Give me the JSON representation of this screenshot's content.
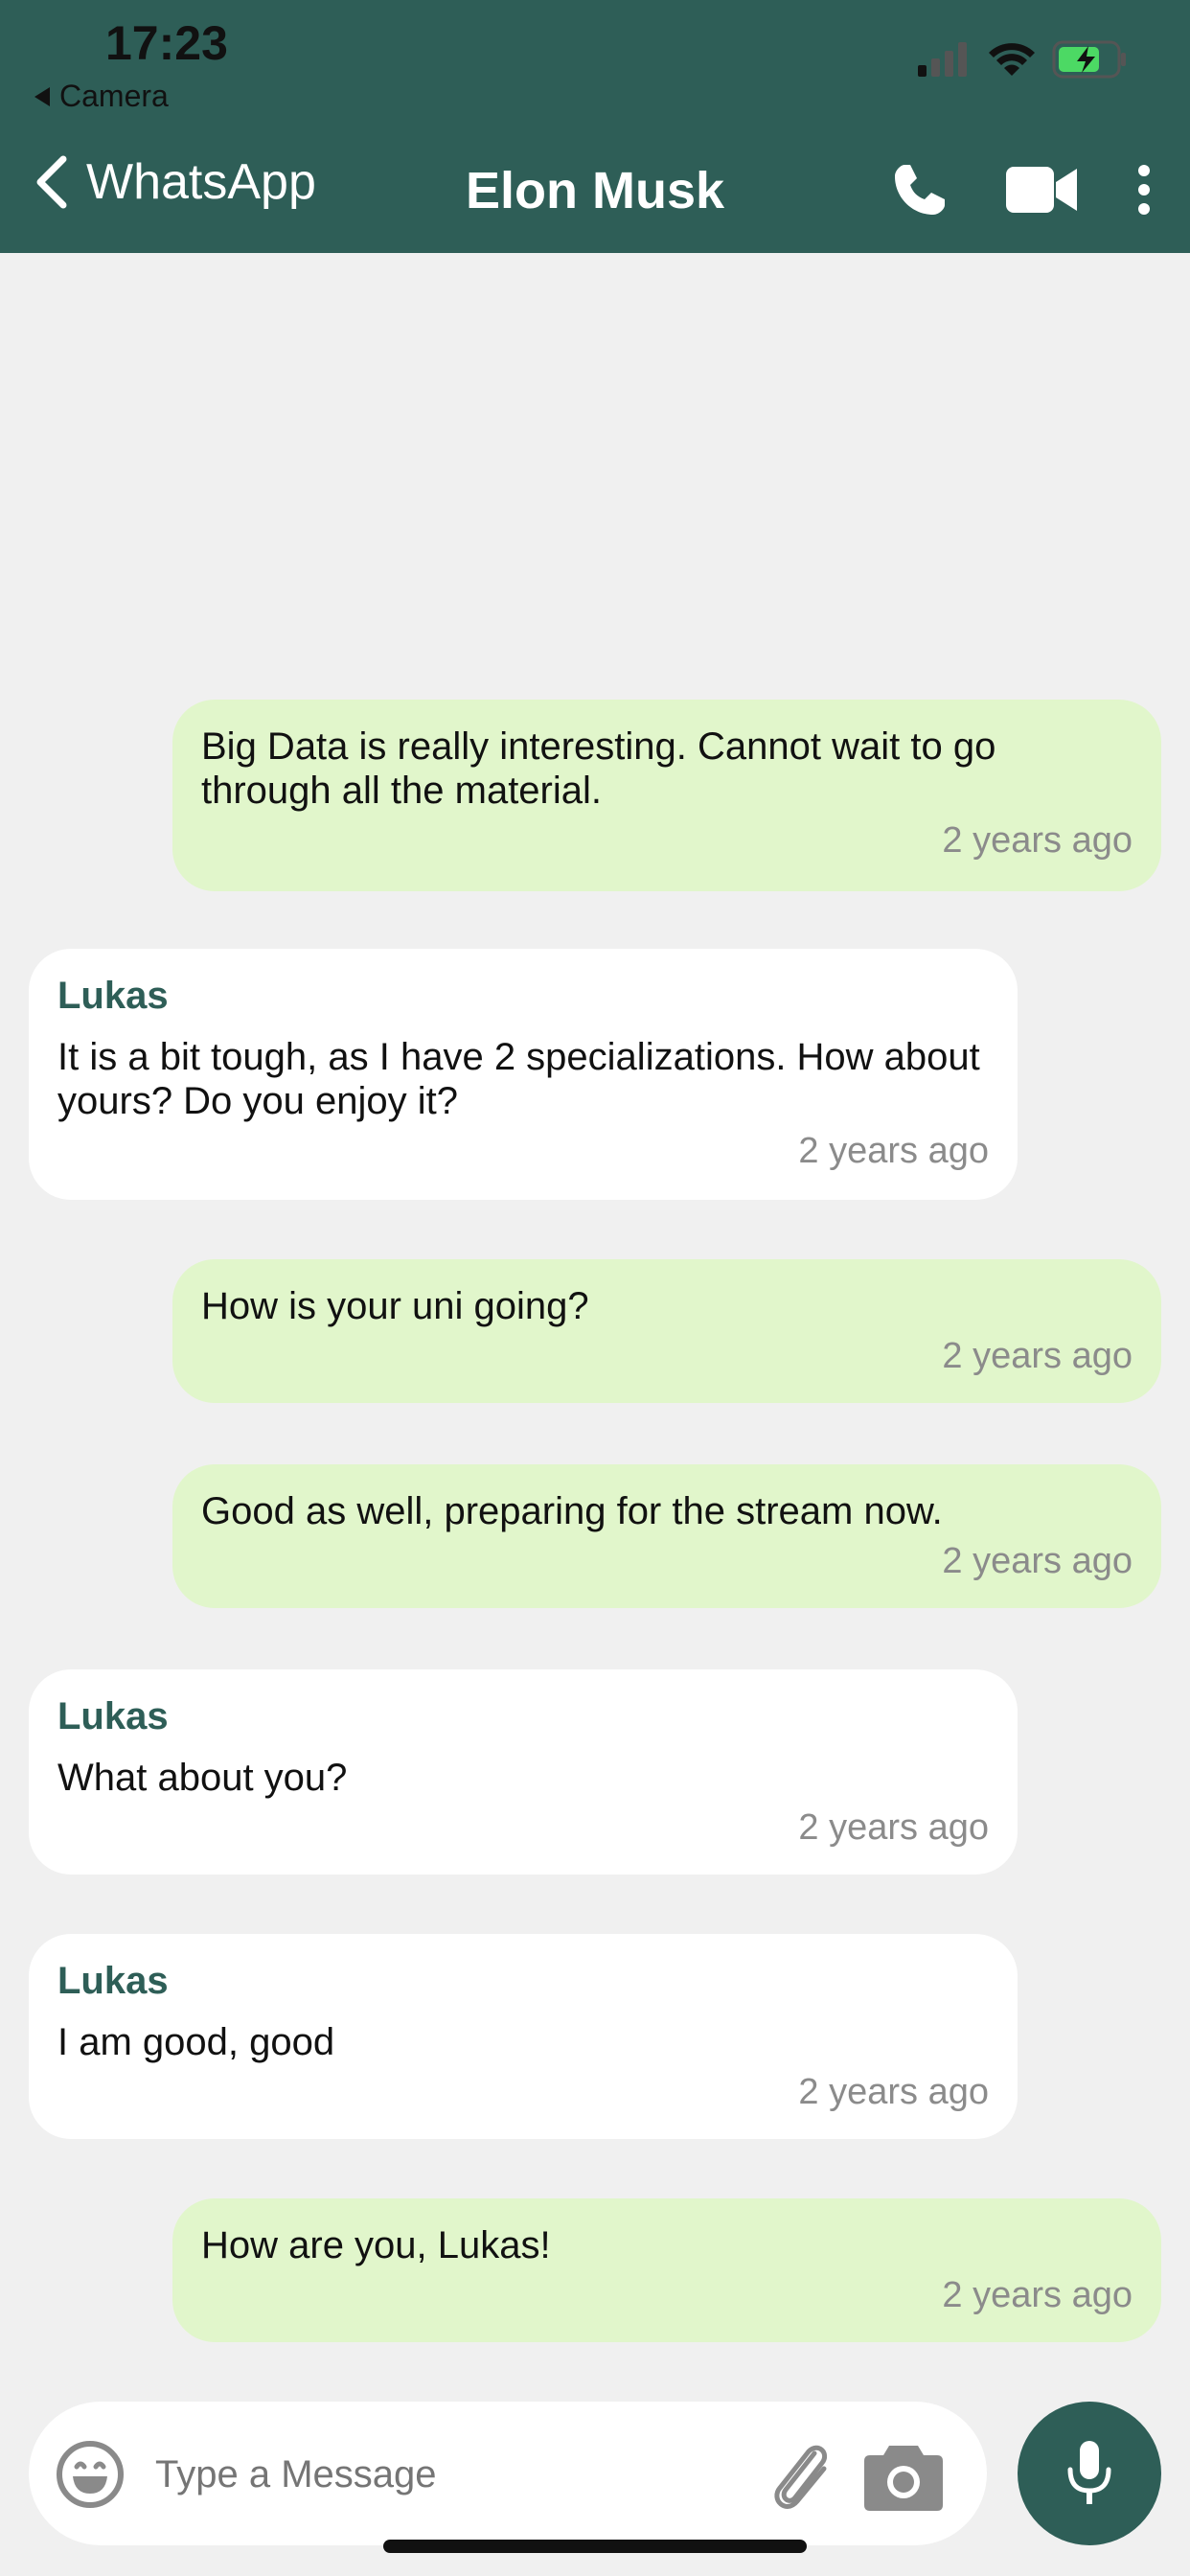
{
  "status": {
    "time": "17:23",
    "back_app": "Camera"
  },
  "nav": {
    "back_label": "WhatsApp",
    "title": "Elon Musk"
  },
  "messages": [
    {
      "type": "outgoing",
      "text": "Big Data is really interesting. Cannot wait to go through all the material.",
      "time": "2 years ago"
    },
    {
      "type": "incoming",
      "sender": "Lukas",
      "text": "It is a bit tough, as I have 2 specializations. How about yours? Do you enjoy it?",
      "time": "2 years ago"
    },
    {
      "type": "outgoing",
      "text": "How is your uni going?",
      "time": "2 years ago"
    },
    {
      "type": "outgoing",
      "text": "Good as well, preparing for the stream now.",
      "time": "2 years ago"
    },
    {
      "type": "incoming",
      "sender": "Lukas",
      "text": "What about you?",
      "time": "2 years ago"
    },
    {
      "type": "incoming",
      "sender": "Lukas",
      "text": "I am good, good",
      "time": "2 years ago"
    },
    {
      "type": "outgoing",
      "text": "How are you, Lukas!",
      "time": "2 years ago"
    }
  ],
  "composer": {
    "placeholder": "Type a Message"
  },
  "colors": {
    "header": "#2e5e57",
    "outgoing_bubble": "#e1f6cb",
    "incoming_bubble": "#ffffff",
    "background": "#f0f0f0"
  }
}
